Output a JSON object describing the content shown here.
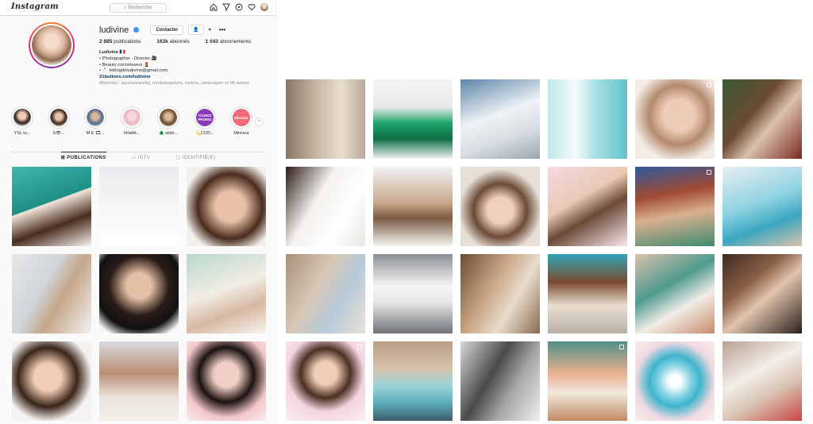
{
  "topbar": {
    "logo": "Instagram",
    "search_placeholder": "Rechercher",
    "icons": [
      "home-icon",
      "direct-icon",
      "explore-icon",
      "heart-icon",
      "profile-avatar"
    ]
  },
  "profile": {
    "username": "ludivine",
    "contact_label": "Contacter",
    "follow_icon": "👤",
    "caret": "▾",
    "more": "•••",
    "stats": [
      {
        "value": "2 885",
        "label": "publications"
      },
      {
        "value": "163k",
        "label": "abonnés"
      },
      {
        "value": "1 043",
        "label": "abonnements"
      }
    ],
    "bio": {
      "name": "Ludivine 🇫🇷",
      "line1": "• Photographer - Director 🎥",
      "line2": "• Beauty connoisseur 💄",
      "line3": "• 📩 leblogdeludivine@gmail.com",
      "link": "21buttons.com/ludivine",
      "followed_by": "Abonnés : aurelaskandaj, modalizaphoto, melina_santangelo et 96 autres"
    }
  },
  "stories": [
    {
      "label": "YSL tu..."
    },
    {
      "label": "S👁..."
    },
    {
      "label": "M E 🎞..."
    },
    {
      "label": "#Habit..."
    },
    {
      "label": "🌲 wish..."
    },
    {
      "label": "💫COD...",
      "badge": "CODES PROMO"
    },
    {
      "label": "Minceur",
      "badge": "Minceur"
    }
  ],
  "tabs": [
    {
      "label": "⊞ PUBLICATIONS",
      "active": true
    },
    {
      "label": "▭ IGTV",
      "active": false
    },
    {
      "label": "▢ IDENTIFIÉ(E)",
      "active": false
    }
  ],
  "colors": {
    "verified": "#3897f0",
    "link": "#003569",
    "border": "#dbdbdb",
    "muted": "#8e8e8e"
  }
}
